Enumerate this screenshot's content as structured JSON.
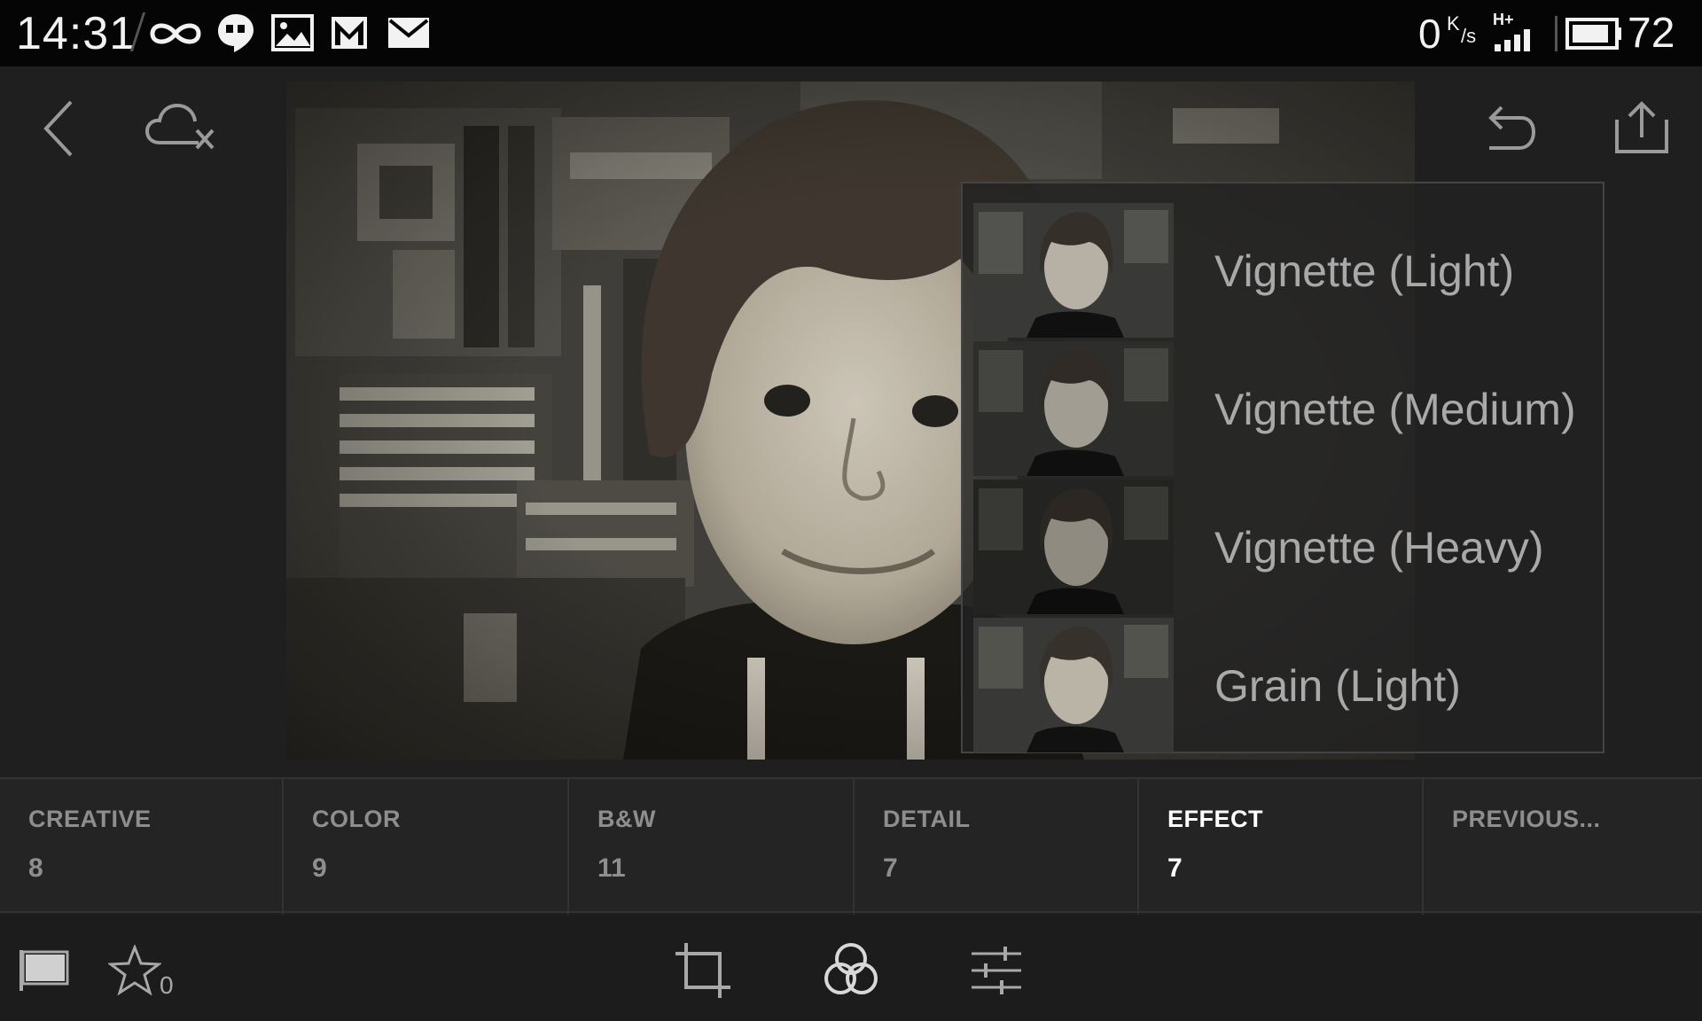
{
  "status_bar": {
    "time": "14:31",
    "net_speed": "0",
    "net_unit_top": "K",
    "net_unit_bottom": "/s",
    "network_type": "H+",
    "battery": "72"
  },
  "presets": [
    {
      "label": "Vignette (Light)"
    },
    {
      "label": "Vignette (Medium)"
    },
    {
      "label": "Vignette (Heavy)"
    },
    {
      "label": "Grain (Light)"
    }
  ],
  "tabs": [
    {
      "name": "CREATIVE",
      "count": "8"
    },
    {
      "name": "COLOR",
      "count": "9"
    },
    {
      "name": "B&W",
      "count": "11"
    },
    {
      "name": "DETAIL",
      "count": "7"
    },
    {
      "name": "EFFECT",
      "count": "7"
    },
    {
      "name": "PREVIOUS...",
      "count": ""
    }
  ],
  "active_tab": "EFFECT",
  "toolbar": {
    "rating_count": "0"
  },
  "colors": {
    "accent_active": "#ffffff",
    "inactive_text": "#8e8e8e",
    "background": "#1f1f1f"
  }
}
